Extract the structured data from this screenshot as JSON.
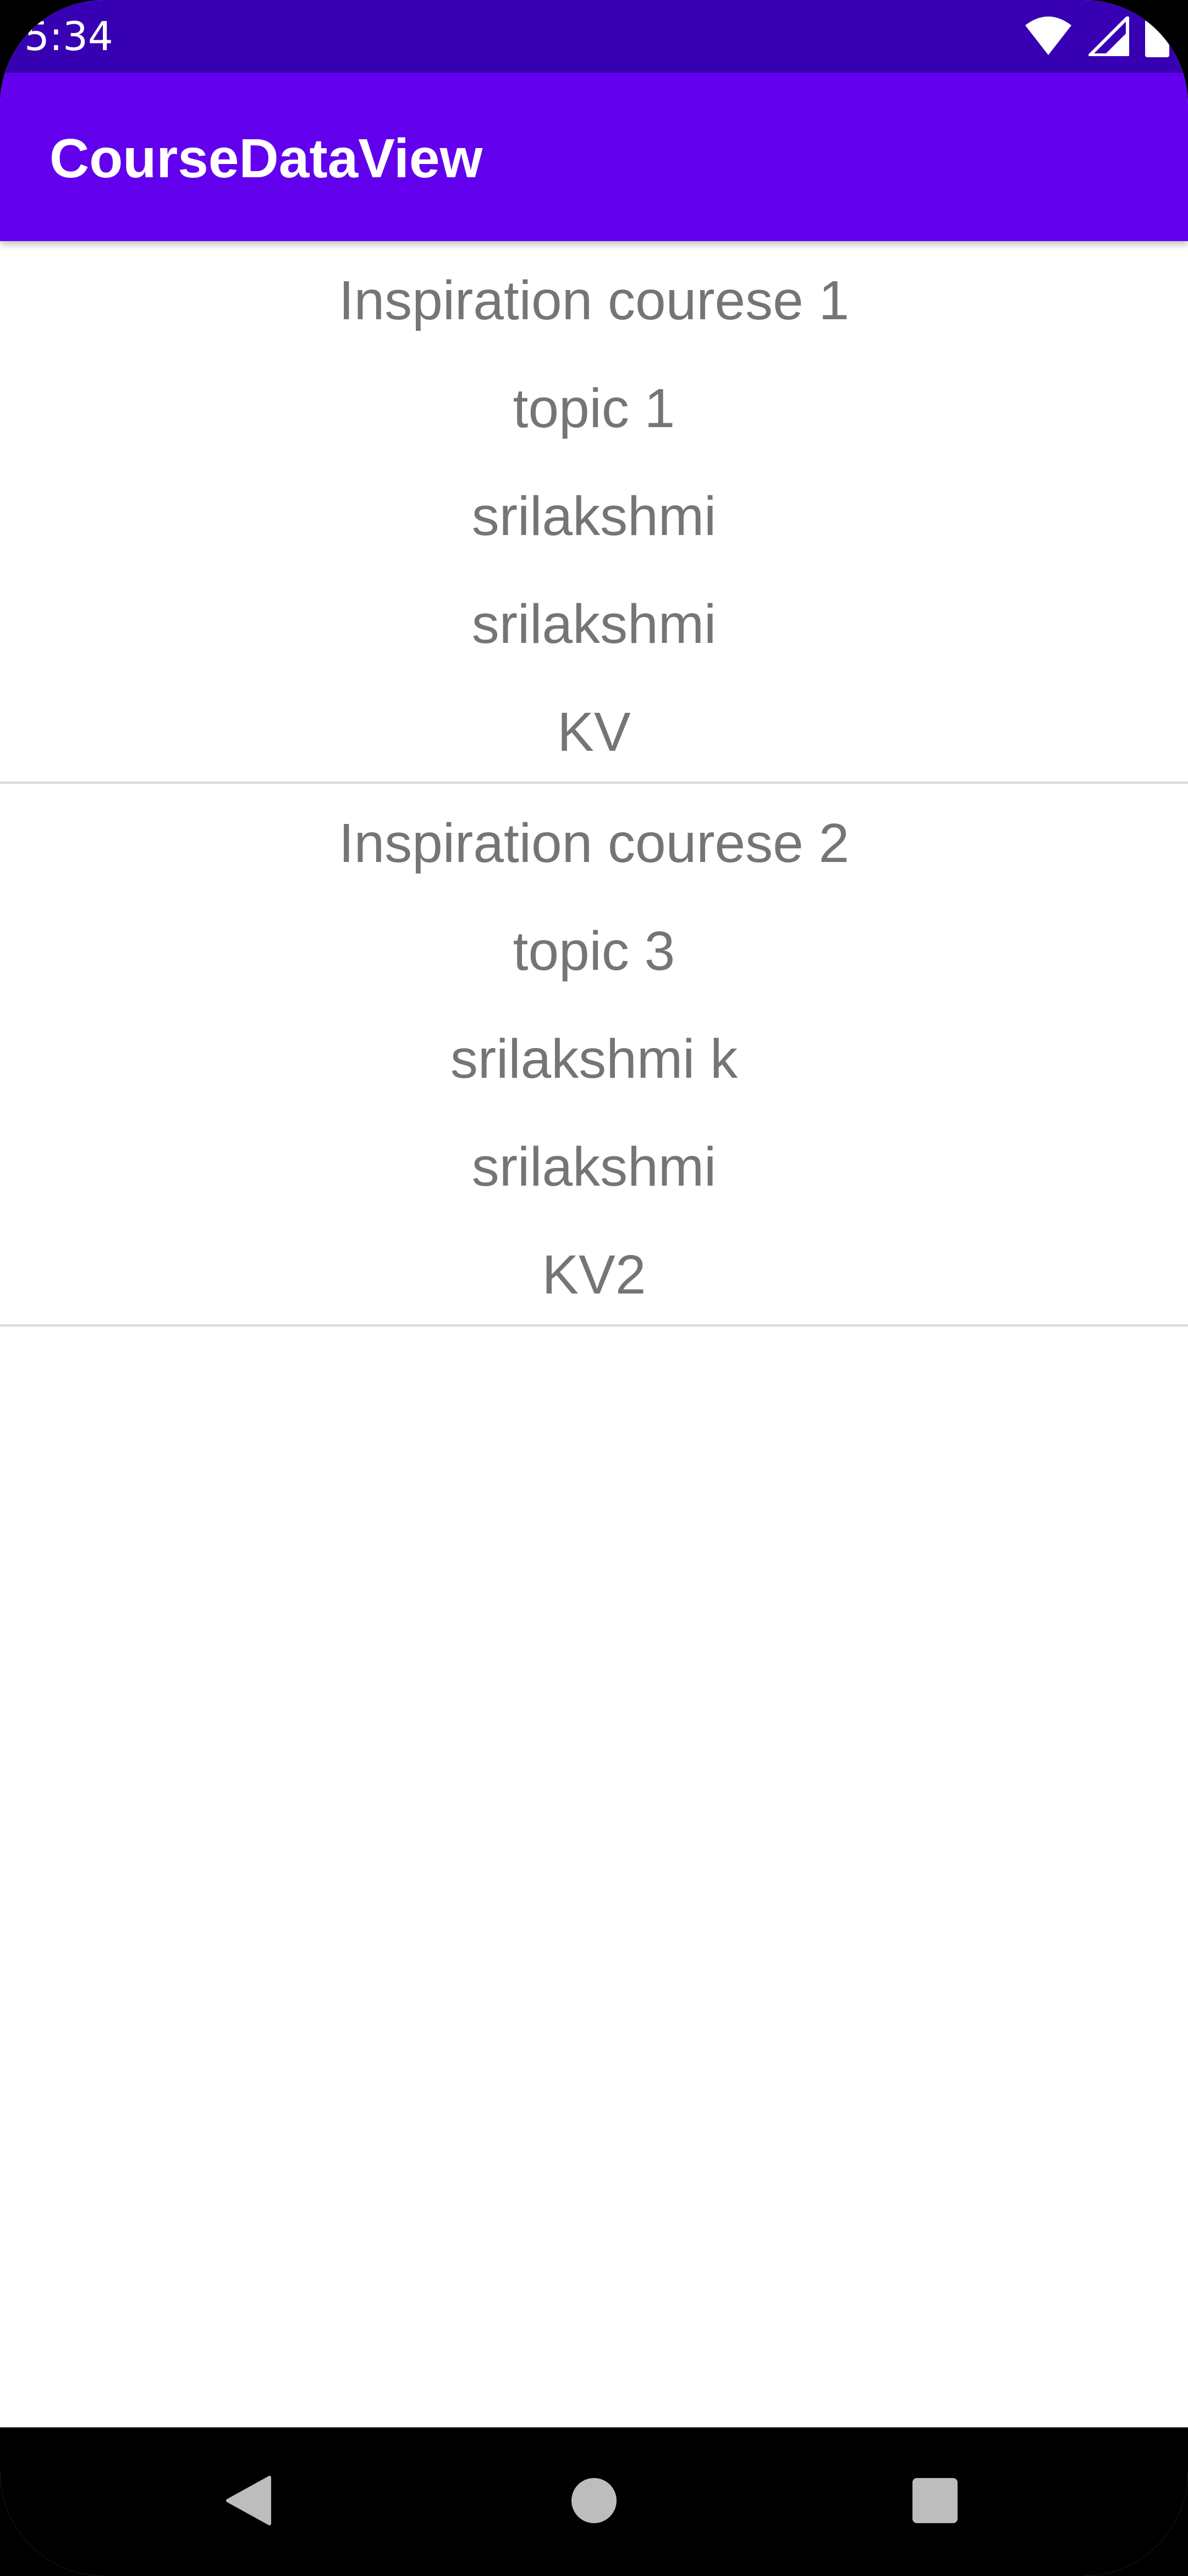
{
  "status_bar": {
    "time": "5:34",
    "background": "#3700b3",
    "icons": [
      "wifi-icon",
      "cellular-signal-icon",
      "battery-icon"
    ]
  },
  "app_bar": {
    "title": "CourseDataView",
    "background": "#6200ee"
  },
  "courses": [
    {
      "name": "Inspiration courese 1",
      "topic": "topic 1",
      "author": "srilakshmi",
      "instructor": "srilakshmi",
      "code": "KV"
    },
    {
      "name": "Inspiration courese 2",
      "topic": "topic 3",
      "author": "srilakshmi k",
      "instructor": "srilakshmi",
      "code": "KV2"
    }
  ],
  "nav_bar": {
    "buttons": [
      "back-icon",
      "home-icon",
      "recents-icon"
    ]
  },
  "colors": {
    "item_text": "#757575",
    "divider": "#d9d9d9"
  }
}
